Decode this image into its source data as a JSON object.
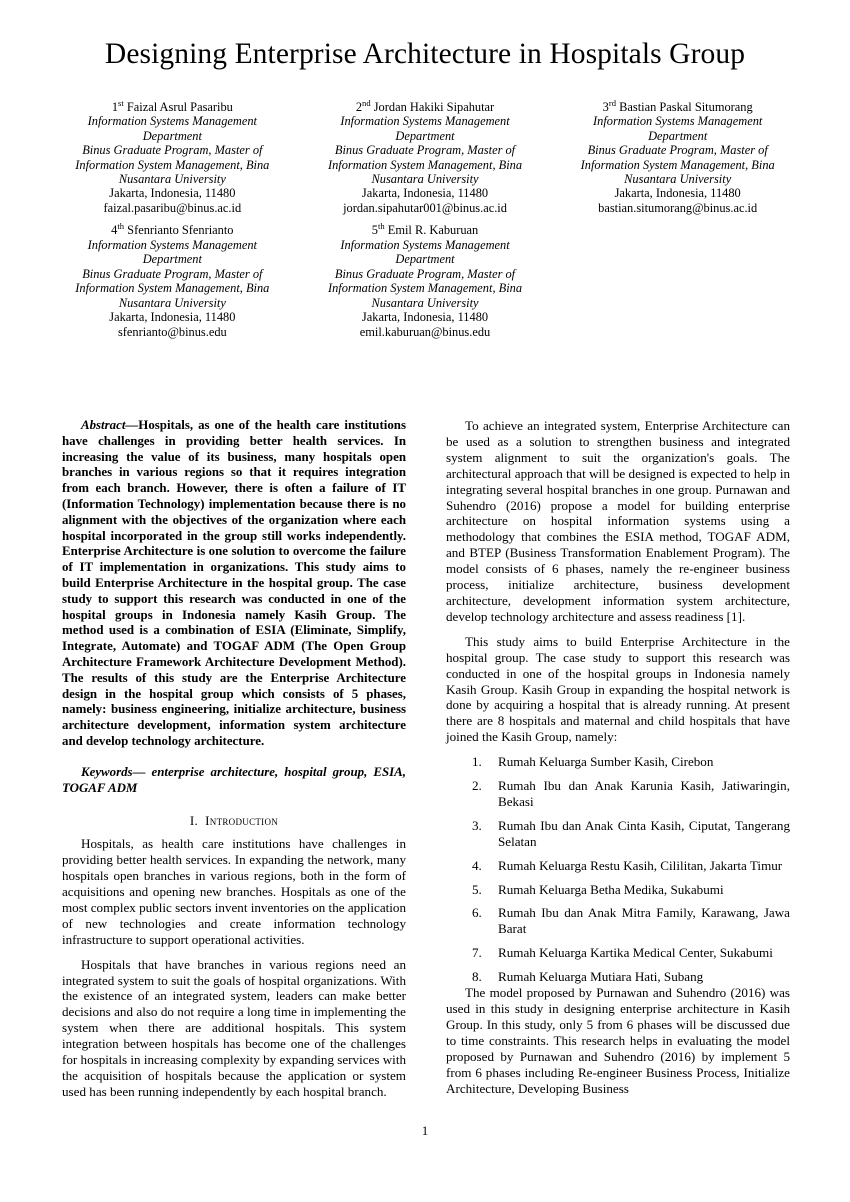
{
  "paper": {
    "title": "Designing Enterprise Architecture in Hospitals Group",
    "page_number": "1"
  },
  "authors": [
    {
      "ordinal": "1",
      "ordinal_suffix": "st",
      "name": "Faizal Asrul Pasaribu",
      "dept_line1": "Information Systems Management",
      "dept_line2": "Department",
      "org_line1": "Binus Graduate Program, Master of",
      "org_line2": "Information System Management, Bina",
      "org_line3": "Nusantara University",
      "location": "Jakarta, Indonesia, 11480",
      "email": "faizal.pasaribu@binus.ac.id"
    },
    {
      "ordinal": "2",
      "ordinal_suffix": "nd",
      "name": "Jordan Hakiki Sipahutar",
      "dept_line1": "Information Systems Management",
      "dept_line2": "Department",
      "org_line1": "Binus Graduate Program, Master of",
      "org_line2": "Information System Management, Bina",
      "org_line3": "Nusantara University",
      "location": "Jakarta, Indonesia, 11480",
      "email": "jordan.sipahutar001@binus.ac.id"
    },
    {
      "ordinal": "3",
      "ordinal_suffix": "rd",
      "name": "Bastian Paskal Situmorang",
      "dept_line1": "Information Systems Management",
      "dept_line2": "Department",
      "org_line1": "Binus Graduate Program, Master of",
      "org_line2": "Information System Management, Bina",
      "org_line3": "Nusantara University",
      "location": "Jakarta, Indonesia, 11480",
      "email": "bastian.situmorang@binus.ac.id"
    },
    {
      "ordinal": "4",
      "ordinal_suffix": "th",
      "name": "Sfenrianto Sfenrianto",
      "dept_line1": "Information Systems Management",
      "dept_line2": "Department",
      "org_line1": "Binus Graduate Program, Master of",
      "org_line2": "Information System Management, Bina",
      "org_line3": "Nusantara University",
      "location": "Jakarta, Indonesia, 11480",
      "email": "sfenrianto@binus.edu"
    },
    {
      "ordinal": "5",
      "ordinal_suffix": "th",
      "name": "Emil R. Kaburuan",
      "dept_line1": "Information Systems Management",
      "dept_line2": "Department",
      "org_line1": "Binus Graduate Program, Master of",
      "org_line2": "Information System Management, Bina",
      "org_line3": "Nusantara University",
      "location": "Jakarta, Indonesia, 11480",
      "email": "emil.kaburuan@binus.edu"
    }
  ],
  "abstract": {
    "lead_label": "Abstract—",
    "text": "Hospitals, as one of the health care institutions have challenges in providing better health services. In increasing the value of its business, many hospitals open branches in various regions so that it requires integration from each branch. However, there is often a failure of IT (Information Technology) implementation because there is no alignment with the objectives of the organization where each hospital incorporated in the group still works independently. Enterprise Architecture is one solution to overcome the failure of IT implementation in organizations. This study aims to build Enterprise Architecture in the hospital group. The case study to support this research was conducted in one of the hospital groups in Indonesia namely Kasih Group. The method used is a combination of ESIA (Eliminate, Simplify, Integrate, Automate) and TOGAF ADM (The Open Group Architecture Framework Architecture Development Method). The results of this study are the Enterprise Architecture design in the hospital group which consists of 5 phases, namely: business engineering, initialize architecture, business architecture development, information system architecture and develop technology architecture."
  },
  "keywords": {
    "text": "Keywords— enterprise architecture, hospital group, ESIA, TOGAF ADM"
  },
  "introduction": {
    "numeral": "I.",
    "heading": "Introduction",
    "paragraph_1": "Hospitals, as health care institutions have challenges in providing better health services. In expanding the network, many hospitals open branches in various regions, both in the form of acquisitions and opening new branches. Hospitals as one of the most complex public sectors invent inventories on the application of new technologies and create information technology infrastructure to support operational activities.",
    "paragraph_2": "Hospitals that have branches in various regions need an integrated system to suit the goals of hospital organizations. With the existence of an integrated system, leaders can make better decisions and also do not require a long time in implementing the system when there are additional hospitals. This system integration between hospitals has become one of the challenges for hospitals in increasing complexity by expanding services with the acquisition of hospitals because the application or system used has been running independently by each hospital branch.",
    "paragraph_3": "To achieve an integrated system, Enterprise Architecture can be used as a solution to strengthen business and integrated system alignment to suit the organization's goals. The architectural approach that will be designed is expected to help in integrating several hospital branches in one group. Purnawan and Suhendro (2016) propose a model for building enterprise architecture on hospital information systems using a methodology that combines the ESIA method, TOGAF ADM, and BTEP (Business Transformation Enablement Program). The model consists of 6 phases, namely the re-engineer business process, initialize architecture, business development architecture, development information system architecture, develop technology architecture and assess readiness [1].",
    "paragraph_4": "This study aims to build Enterprise Architecture in the hospital group. The case study to support this research was conducted in one of the hospital groups in Indonesia namely Kasih Group. Kasih Group in expanding the hospital network is done by acquiring a hospital that is already running. At present there are 8 hospitals and maternal and child hospitals that have joined the Kasih Group, namely:",
    "paragraph_5": "The model proposed by Purnawan and Suhendro (2016) was used in this study in designing enterprise architecture in Kasih Group. In this study, only 5 from 6 phases will be discussed due to time constraints. This research helps in evaluating the model proposed by Purnawan and Suhendro (2016) by implement 5 from 6 phases including Re-engineer Business Process, Initialize Architecture, Developing Business"
  },
  "hospital_list": [
    "Rumah Keluarga Sumber Kasih, Cirebon",
    "Rumah Ibu dan Anak Karunia Kasih, Jatiwaringin, Bekasi",
    "Rumah Ibu dan Anak Cinta Kasih, Ciputat, Tangerang Selatan",
    "Rumah Keluarga Restu Kasih, Cililitan, Jakarta Timur",
    "Rumah Keluarga Betha Medika, Sukabumi",
    "Rumah Ibu dan Anak Mitra Family, Karawang, Jawa Barat",
    "Rumah Keluarga Kartika Medical Center, Sukabumi",
    "Rumah Keluarga Mutiara Hati, Subang"
  ]
}
